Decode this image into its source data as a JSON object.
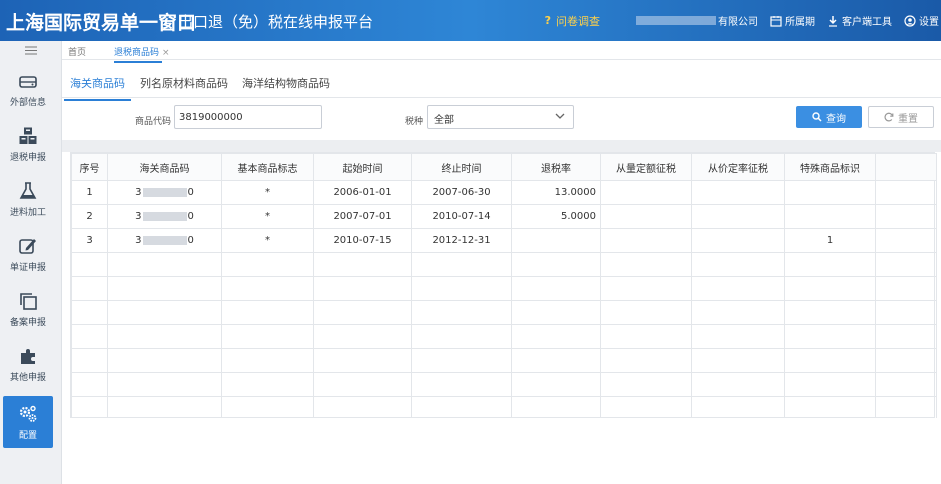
{
  "header": {
    "brand": "上海国际贸易单一窗口",
    "subtitle": "出口退（免）税在线申报平台",
    "survey": "问卷调查",
    "company_suffix": "有限公司",
    "items": [
      {
        "label": "所属期",
        "icon": "calendar-icon"
      },
      {
        "label": "客户端工具",
        "icon": "download-icon"
      },
      {
        "label": "设置",
        "icon": "user-icon"
      }
    ],
    "colors": {
      "bar": "#2e86d6",
      "survey": "#ffd24a"
    }
  },
  "sidebar": {
    "items": [
      {
        "label": "外部信息",
        "icon": "drive-icon"
      },
      {
        "label": "退税申报",
        "icon": "boxes-icon"
      },
      {
        "label": "进料加工",
        "icon": "flask-icon"
      },
      {
        "label": "单证申报",
        "icon": "edit-icon"
      },
      {
        "label": "备案申报",
        "icon": "copy-icon"
      },
      {
        "label": "其他申报",
        "icon": "puzzle-icon"
      },
      {
        "label": "配置",
        "icon": "gears-icon",
        "active": true
      }
    ],
    "active_color": "#2b7fd6"
  },
  "tabs": [
    {
      "label": "首页",
      "active": false
    },
    {
      "label": "退税商品码",
      "active": true,
      "close": "×"
    }
  ],
  "subtabs": [
    {
      "label": "海关商品码",
      "active": true
    },
    {
      "label": "列名原材料商品码",
      "active": false
    },
    {
      "label": "海洋结构物商品码",
      "active": false
    }
  ],
  "search": {
    "code_label": "商品代码",
    "code_value": "3819000000",
    "tax_label": "税种",
    "tax_value": "全部",
    "query_label": "查询",
    "reset_label": "重置"
  },
  "table": {
    "headers": [
      "序号",
      "海关商品码",
      "基本商品标志",
      "起始时间",
      "终止时间",
      "退税率",
      "从量定额征税",
      "从价定率征税",
      "特殊商品标识",
      ""
    ],
    "rows": [
      {
        "no": "1",
        "code_prefix": "3",
        "code_suffix": "0",
        "flag": "*",
        "start": "2006-01-01",
        "end": "2007-06-30",
        "rate": "13.0000",
        "qty_tax": "",
        "val_tax": "",
        "special": ""
      },
      {
        "no": "2",
        "code_prefix": "3",
        "code_suffix": "0",
        "flag": "*",
        "start": "2007-07-01",
        "end": "2010-07-14",
        "rate": "5.0000",
        "qty_tax": "",
        "val_tax": "",
        "special": ""
      },
      {
        "no": "3",
        "code_prefix": "3",
        "code_suffix": "0",
        "flag": "*",
        "start": "2010-07-15",
        "end": "2012-12-31",
        "rate": "",
        "qty_tax": "",
        "val_tax": "",
        "special": "1"
      }
    ]
  }
}
